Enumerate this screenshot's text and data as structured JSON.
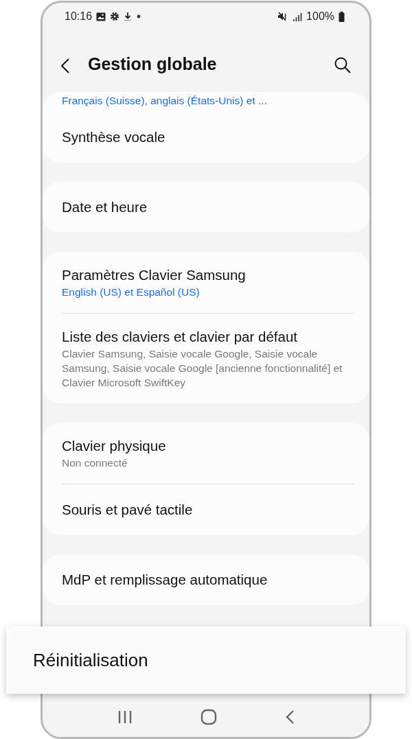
{
  "status_bar": {
    "time": "10:16",
    "battery": "100%"
  },
  "header": {
    "title": "Gestion globale"
  },
  "groups": [
    {
      "items": [
        {
          "kind": "clipped",
          "subtitle": "Français (Suisse), anglais (États-Unis) et ...",
          "subtitle_accent": true
        },
        {
          "kind": "item",
          "title": "Synthèse vocale"
        }
      ]
    },
    {
      "items": [
        {
          "kind": "item",
          "title": "Date et heure"
        }
      ]
    },
    {
      "items": [
        {
          "kind": "item",
          "title": "Paramètres Clavier Samsung",
          "subtitle": "English (US) et Español (US)",
          "subtitle_accent": true
        },
        {
          "kind": "item",
          "title": "Liste des claviers et clavier par défaut",
          "subtitle": "Clavier Samsung, Saisie vocale Google, Saisie vocale Samsung, Saisie vocale Google [ancienne fonctionnalité] et Clavier Microsoft SwiftKey",
          "subtitle_accent": false
        }
      ]
    },
    {
      "items": [
        {
          "kind": "item",
          "title": "Clavier physique",
          "subtitle": "Non connecté",
          "subtitle_accent": false
        },
        {
          "kind": "item",
          "title": "Souris et pavé tactile"
        }
      ]
    },
    {
      "items": [
        {
          "kind": "item",
          "title": "MdP et remplissage automatique"
        }
      ]
    }
  ],
  "highlight": {
    "title": "Réinitialisation"
  }
}
